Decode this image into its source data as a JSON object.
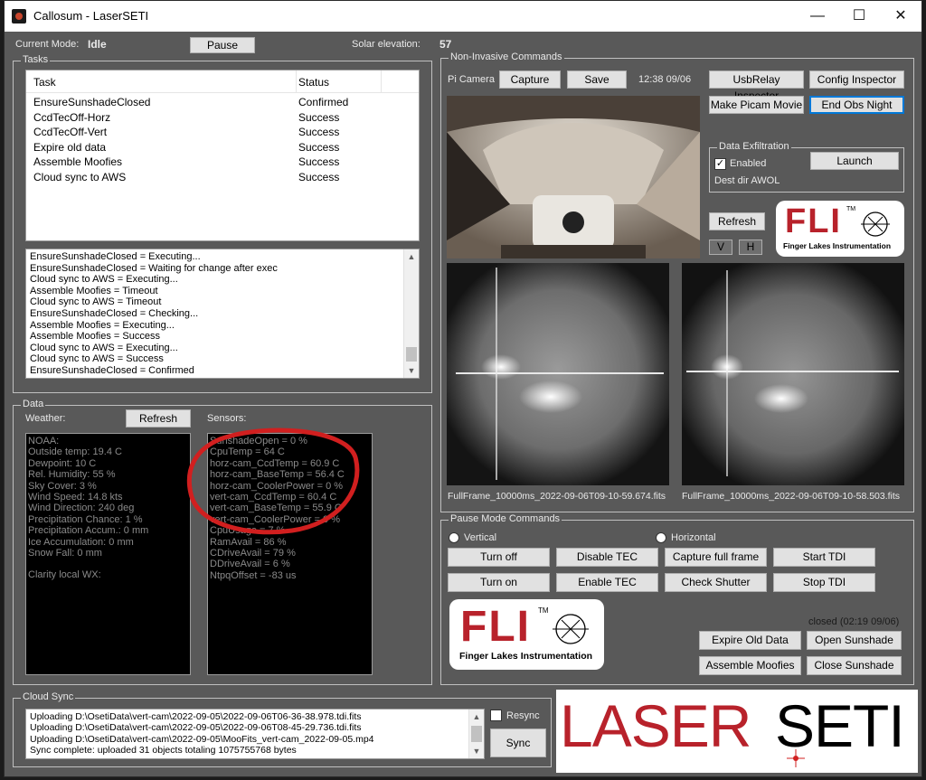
{
  "window": {
    "title": "Callosum - LaserSETI",
    "min_icon": "minimize-icon",
    "max_icon": "maximize-icon",
    "close_icon": "close-icon"
  },
  "status": {
    "mode_label": "Current Mode:",
    "mode_value": "Idle",
    "pause_label": "Pause",
    "solar_label": "Solar elevation:",
    "solar_value": "57"
  },
  "tasks": {
    "group_label": "Tasks",
    "columns": [
      "Task",
      "Status"
    ],
    "rows": [
      {
        "task": "EnsureSunshadeClosed",
        "status": "Confirmed"
      },
      {
        "task": "CcdTecOff-Horz",
        "status": "Success"
      },
      {
        "task": "CcdTecOff-Vert",
        "status": "Success"
      },
      {
        "task": "Expire old data",
        "status": "Success"
      },
      {
        "task": "Assemble Moofies",
        "status": "Success"
      },
      {
        "task": "Cloud sync to AWS",
        "status": "Success"
      }
    ],
    "log": [
      "EnsureSunshadeClosed = Executing...",
      "EnsureSunshadeClosed = Waiting for change after exec",
      "Cloud sync to AWS = Executing...",
      "Assemble Moofies = Timeout",
      "Cloud sync to AWS = Timeout",
      "EnsureSunshadeClosed = Checking...",
      "Assemble Moofies = Executing...",
      "Assemble Moofies = Success",
      "Cloud sync to AWS = Executing...",
      "Cloud sync to AWS = Success",
      "EnsureSunshadeClosed = Confirmed"
    ]
  },
  "data": {
    "group_label": "Data",
    "weather_label": "Weather:",
    "refresh_label": "Refresh",
    "sensors_label": "Sensors:",
    "weather": [
      "NOAA:",
      "Outside temp: 19.4 C",
      "Dewpoint: 10 C",
      "Rel. Humidity: 55 %",
      "Sky Cover: 3 %",
      "Wind Speed: 14.8 kts",
      "Wind Direction: 240 deg",
      "Precipitation Chance: 1 %",
      "Precipitation Accum.: 0 mm",
      "Ice Accumulation: 0 mm",
      "Snow Fall: 0 mm",
      "",
      "Clarity local WX:"
    ],
    "sensors": [
      "SunshadeOpen = 0 %",
      "CpuTemp = 64 C",
      "horz-cam_CcdTemp = 60.9 C",
      "horz-cam_BaseTemp = 56.4 C",
      "horz-cam_CoolerPower = 0 %",
      "vert-cam_CcdTemp = 60.4 C",
      "vert-cam_BaseTemp = 55.9 C",
      "vert-cam_CoolerPower = 0 %",
      "CpuUsage = 7 %",
      "RamAvail = 86 %",
      "CDriveAvail = 79 %",
      "DDriveAvail = 6 %",
      "NtpqOffset = -83 us"
    ]
  },
  "noninvasive": {
    "group_label": "Non-Invasive Commands",
    "pi_camera_label": "Pi Camera",
    "capture_label": "Capture",
    "save_label": "Save",
    "timestamp": "12:38 09/06",
    "usbrelay_label": "UsbRelay Inspector",
    "config_label": "Config Inspector",
    "picam_movie_label": "Make Picam Movie",
    "end_obs_label": "End Obs Night",
    "exfil_label": "Data Exfiltration",
    "enabled_label": "Enabled",
    "launch_label": "Launch",
    "dest_dir": "Dest dir AWOL",
    "refresh_label": "Refresh",
    "v_label": "V",
    "h_label": "H",
    "frame1_caption": "FullFrame_10000ms_2022-09-06T09-10-59.674.fits",
    "frame2_caption": "FullFrame_10000ms_2022-09-06T09-10-58.503.fits"
  },
  "fli": {
    "word": "FLI",
    "tm": "TM",
    "sub": "Finger Lakes Instrumentation"
  },
  "pause_cmds": {
    "group_label": "Pause Mode Commands",
    "vertical_label": "Vertical",
    "horizontal_label": "Horizontal",
    "turn_off": "Turn off",
    "turn_on": "Turn on",
    "disable_tec": "Disable TEC",
    "enable_tec": "Enable TEC",
    "capture_full": "Capture full frame",
    "check_shutter": "Check Shutter",
    "start_tdi": "Start TDI",
    "stop_tdi": "Stop TDI",
    "closed_status": "closed (02:19 09/06)",
    "expire_old": "Expire Old Data",
    "open_sunshade": "Open Sunshade",
    "assemble_moofies": "Assemble Moofies",
    "close_sunshade": "Close Sunshade"
  },
  "cloud_sync": {
    "group_label": "Cloud Sync",
    "log": [
      "Uploading D:\\OsetiData\\vert-cam\\2022-09-05\\2022-09-06T06-36-38.978.tdi.fits",
      "Uploading D:\\OsetiData\\vert-cam\\2022-09-05\\2022-09-06T08-45-29.736.tdi.fits",
      "Uploading D:\\OsetiData\\vert-cam\\2022-09-05\\MooFits_vert-cam_2022-09-05.mp4",
      "Sync complete: uploaded 31 objects totaling 1075755768 bytes"
    ],
    "resync_label": "Resync",
    "sync_label": "Sync"
  },
  "brand": {
    "laser": "LASER",
    "seti": "SETI"
  },
  "colors": {
    "brand_red": "#b8222b",
    "annotation_red": "#d11f1f",
    "window_bg": "#595959"
  }
}
